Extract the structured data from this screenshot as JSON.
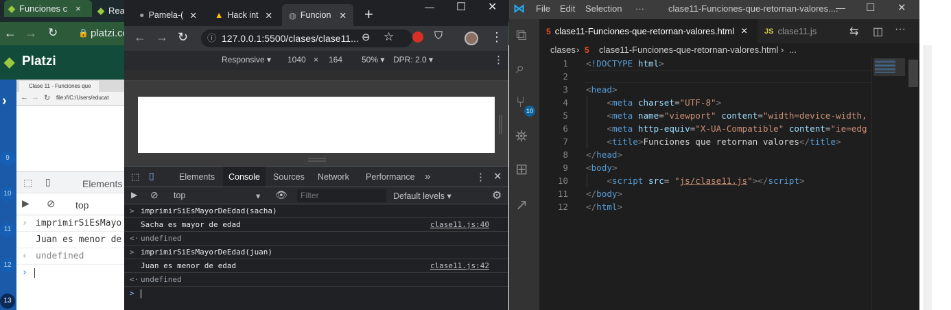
{
  "bg_browser": {
    "tabs": [
      {
        "label": "Funciones c",
        "close": "×"
      },
      {
        "label": "Rea"
      }
    ],
    "url": "platzi.co",
    "site_name": "Platzi",
    "inner": {
      "tab_label": "Clase 11 - Funciones que",
      "url": "file:///C:/Users/educat",
      "panel_tab": "Elements",
      "context": "top",
      "console_lines": [
        "imprimirSiEsMayo",
        "Juan es menor de",
        "undefined"
      ],
      "line_numbers": [
        "9",
        "10",
        "11",
        "12",
        "13"
      ]
    }
  },
  "devtools_window": {
    "tabs": [
      {
        "label": "Pamela-("
      },
      {
        "label": "Hack int"
      },
      {
        "label": "Funcion"
      }
    ],
    "new_tab": "+",
    "window_controls": {
      "minimize": "—",
      "maximize": "☐",
      "close": "✕"
    },
    "url": "127.0.0.1:5500/clases/clase11...",
    "device": {
      "mode": "Responsive",
      "width": "1040",
      "times": "×",
      "height": "164",
      "zoom": "50%",
      "dpr": "DPR: 2.0"
    },
    "panel_tabs": [
      "Elements",
      "Console",
      "Sources",
      "Network",
      "Performance"
    ],
    "more_tabs": "»",
    "console_bar": {
      "context": "top",
      "filter_placeholder": "Filter",
      "levels": "Default levels"
    },
    "console_lines": [
      {
        "gutter": ">",
        "text": "imprimirSiEsMayorDeEdad(sacha)",
        "source": "",
        "color": "#e8eaed"
      },
      {
        "gutter": "",
        "text": "Sacha es mayor de edad",
        "source": "clase11.js:40",
        "color": "#e8eaed"
      },
      {
        "gutter": "<·",
        "text": "undefined",
        "source": "",
        "color": "#9aa0a6"
      },
      {
        "gutter": ">",
        "text": "imprimirSiEsMayorDeEdad(juan)",
        "source": "",
        "color": "#e8eaed"
      },
      {
        "gutter": "",
        "text": "Juan es menor de edad",
        "source": "clase11.js:42",
        "color": "#e8eaed"
      },
      {
        "gutter": "<·",
        "text": "undefined",
        "source": "",
        "color": "#9aa0a6"
      }
    ],
    "prompt": ">"
  },
  "vscode": {
    "menu": [
      "File",
      "Edit",
      "Selection",
      "···"
    ],
    "title": "clase11-Funciones-que-retornan-valores....",
    "window_controls": {
      "minimize": "—",
      "maximize": "☐",
      "close": "✕"
    },
    "tabs": [
      {
        "label": "clase11-Funciones-que-retornan-valores.html",
        "close": "×",
        "active": true
      },
      {
        "label": "clase11.js",
        "badge": "JS"
      }
    ],
    "git_badge": "10",
    "breadcrumb": {
      "folder": "clases",
      "file": "clase11-Funciones-que-retornan-valores.html",
      "more": "..."
    },
    "code_lines": [
      {
        "n": "1",
        "html": "<span class='bracket'>&lt;</span><span class='tag'>!DOCTYPE</span> <span class='attr'>html</span><span class='bracket'>&gt;</span>"
      },
      {
        "n": "2",
        "html": ""
      },
      {
        "n": "3",
        "html": "<span class='bracket'>&lt;</span><span class='tag'>head</span><span class='bracket'>&gt;</span>"
      },
      {
        "n": "4",
        "html": "    <span class='bracket'>&lt;</span><span class='tag'>meta</span> <span class='attr'>charset</span>=<span class='str'>\"UTF-8\"</span><span class='bracket'>&gt;</span>"
      },
      {
        "n": "5",
        "html": "    <span class='bracket'>&lt;</span><span class='tag'>meta</span> <span class='attr'>name</span>=<span class='str'>\"viewport\"</span> <span class='attr'>content</span>=<span class='str'>\"width=device-width,</span>"
      },
      {
        "n": "6",
        "html": "    <span class='bracket'>&lt;</span><span class='tag'>meta</span> <span class='attr'>http-equiv</span>=<span class='str'>\"X-UA-Compatible\"</span> <span class='attr'>content</span>=<span class='str'>\"ie=edg</span>"
      },
      {
        "n": "7",
        "html": "    <span class='bracket'>&lt;</span><span class='tag'>title</span><span class='bracket'>&gt;</span>Funciones que retornan valores<span class='bracket'>&lt;/</span><span class='tag'>title</span><span class='bracket'>&gt;</span>"
      },
      {
        "n": "8",
        "html": "<span class='bracket'>&lt;/</span><span class='tag'>head</span><span class='bracket'>&gt;</span>"
      },
      {
        "n": "9",
        "html": "<span class='bracket'>&lt;</span><span class='tag'>body</span><span class='bracket'>&gt;</span>"
      },
      {
        "n": "10",
        "html": "    <span class='bracket'>&lt;</span><span class='tag'>script</span> <span class='attr'>src</span>= <span class='str'>\"<u>js/clase11.js</u>\"</span><span class='bracket'>&gt;&lt;/</span><span class='tag'>script</span><span class='bracket'>&gt;</span>"
      },
      {
        "n": "11",
        "html": "<span class='bracket'>&lt;/</span><span class='tag'>body</span><span class='bracket'>&gt;</span>"
      },
      {
        "n": "12",
        "html": "<span class='bracket'>&lt;/</span><span class='tag'>html</span><span class='bracket'>&gt;</span>"
      }
    ]
  },
  "colors": {
    "platzi_green": "#98ca3f",
    "vscode_blue": "#007acc",
    "git_badge": "#0e639c"
  }
}
